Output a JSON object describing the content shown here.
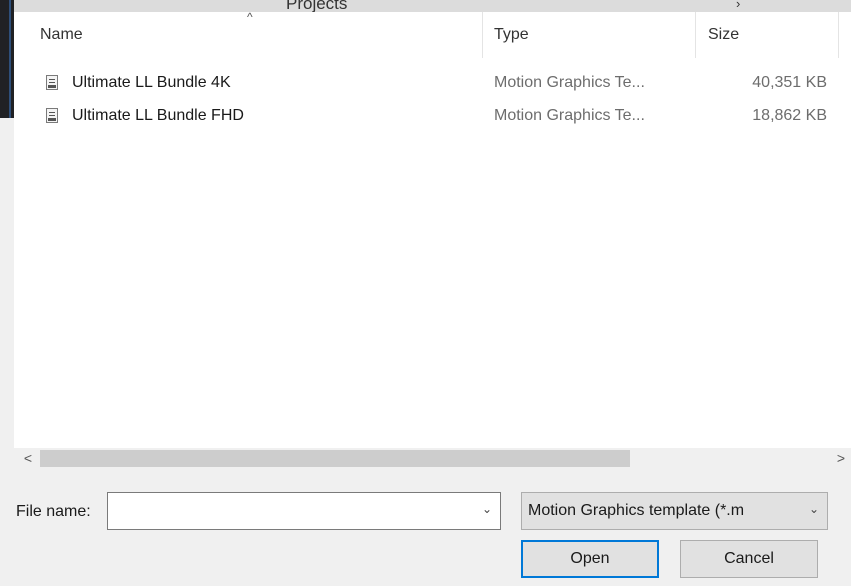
{
  "breadcrumb": {
    "current": "Projects"
  },
  "columns": {
    "name": "Name",
    "type": "Type",
    "size": "Size"
  },
  "files": [
    {
      "name": "Ultimate LL Bundle 4K",
      "type": "Motion Graphics Te...",
      "size": "40,351 KB",
      "icon": "motion-graphics-file-icon"
    },
    {
      "name": "Ultimate LL Bundle FHD",
      "type": "Motion Graphics Te...",
      "size": "18,862 KB",
      "icon": "motion-graphics-file-icon"
    }
  ],
  "footer": {
    "file_name_label": "File name:",
    "file_name_value": "",
    "file_type_selected": "Motion Graphics template (*.m",
    "open_label": "Open",
    "cancel_label": "Cancel"
  },
  "colors": {
    "accent": "#0078d7",
    "window_bg": "#f0f0f0",
    "list_bg": "#ffffff"
  }
}
